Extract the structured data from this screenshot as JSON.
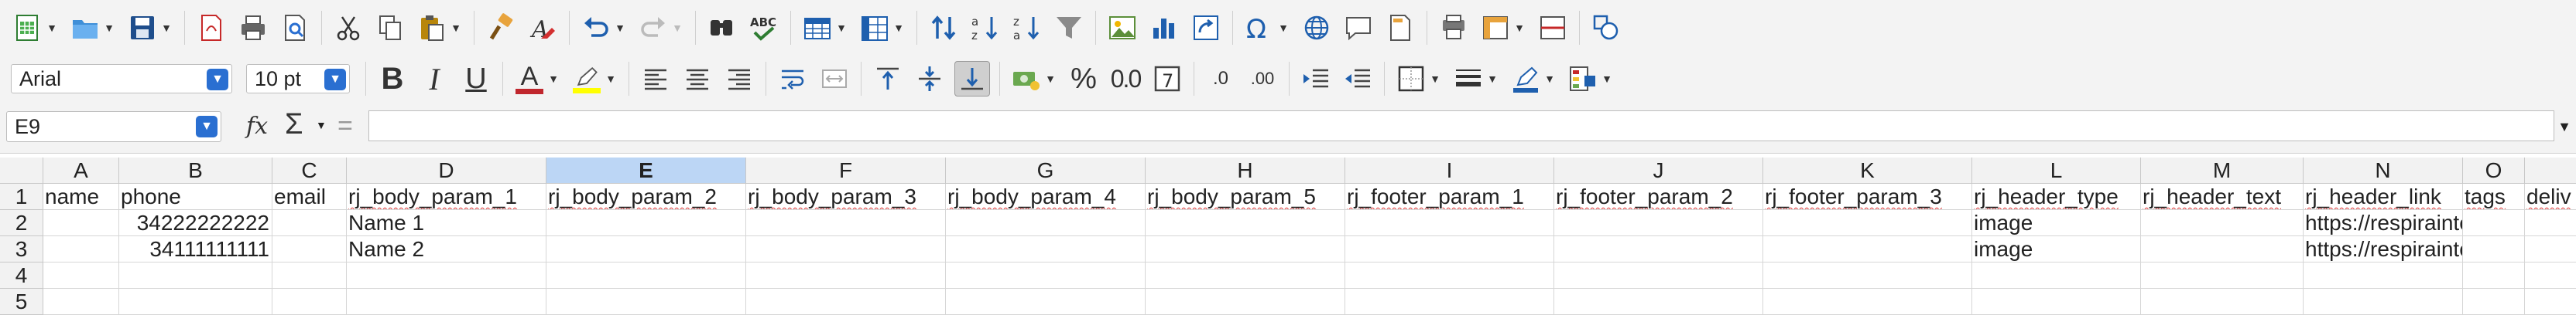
{
  "toolbar2": {
    "font_name": "Arial",
    "font_size": "10 pt",
    "bold": "B",
    "italic": "I",
    "underline": "U",
    "font_color_glyph": "A",
    "percent": "%",
    "number_format": "0.0",
    "add_decimal": ".0",
    "del_decimal": ".00",
    "font_color": "#c0262d",
    "highlight_color": "#ffff00"
  },
  "formula_bar": {
    "name_box": "E9",
    "fx": "fx",
    "sigma": "Σ",
    "equals": "=",
    "content": ""
  },
  "sheet": {
    "selected_column": "E",
    "selected_row": "9",
    "columns": [
      "A",
      "B",
      "C",
      "D",
      "E",
      "F",
      "G",
      "H",
      "I",
      "J",
      "K",
      "L",
      "M",
      "N",
      "O",
      ""
    ],
    "rows": [
      {
        "num": "1",
        "cells": [
          "name",
          "phone",
          "email",
          "rj_body_param_1",
          "rj_body_param_2",
          "rj_body_param_3",
          "rj_body_param_4",
          "rj_body_param_5",
          "rj_footer_param_1",
          "rj_footer_param_2",
          "rj_footer_param_3",
          "rj_header_type",
          "rj_header_text",
          "rj_header_link",
          "tags",
          "deliv"
        ]
      },
      {
        "num": "2",
        "cells": [
          "",
          "34222222222",
          "",
          "Name 1",
          "",
          "",
          "",
          "",
          "",
          "",
          "",
          "image",
          "",
          "https://respirainternet.com/",
          "",
          ""
        ]
      },
      {
        "num": "3",
        "cells": [
          "",
          "34111111111",
          "",
          "Name 2",
          "",
          "",
          "",
          "",
          "",
          "",
          "",
          "image",
          "",
          "https://respirainternet.com/",
          "",
          ""
        ]
      },
      {
        "num": "4",
        "cells": [
          "",
          "",
          "",
          "",
          "",
          "",
          "",
          "",
          "",
          "",
          "",
          "",
          "",
          "",
          "",
          ""
        ]
      },
      {
        "num": "5",
        "cells": [
          "",
          "",
          "",
          "",
          "",
          "",
          "",
          "",
          "",
          "",
          "",
          "",
          "",
          "",
          "",
          ""
        ]
      }
    ]
  }
}
